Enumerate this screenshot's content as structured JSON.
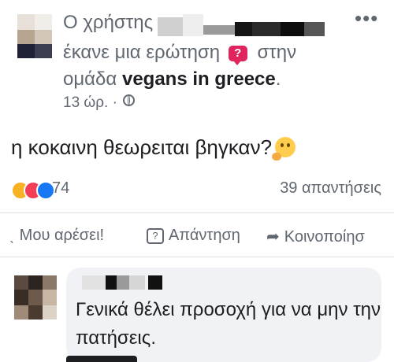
{
  "post": {
    "author_prefix": "Ο χρήστης",
    "action_text": "έκανε μια ερώτηση",
    "question_badge": "?",
    "in_word": "στην",
    "group_prefix": "ομάδα",
    "group_name": "vegans in greece",
    "group_suffix": ".",
    "time": "13 ώρ.",
    "separator": "·",
    "privacy_icon": "globe-icon",
    "more_label": "•••",
    "body_text": "η κοκαινη θεωρειται βηγκαν?",
    "body_emoji": "thinking-face-icon"
  },
  "stats": {
    "reaction_icons": [
      "haha-icon",
      "love-icon",
      "like-icon"
    ],
    "reaction_count": "74",
    "answers_count": "39 απαντήσεις"
  },
  "actions": {
    "like_label": "Μου αρέσει!",
    "answer_label": "Απάντηση",
    "share_label": "Κοινοποίησ"
  },
  "comment": {
    "text": "Γενικά θέλει προσοχή για να μην την πατήσεις."
  },
  "colors": {
    "question_badge": "#e0245e",
    "secondary_text": "#606770",
    "bubble_bg": "#f0f2f5"
  }
}
